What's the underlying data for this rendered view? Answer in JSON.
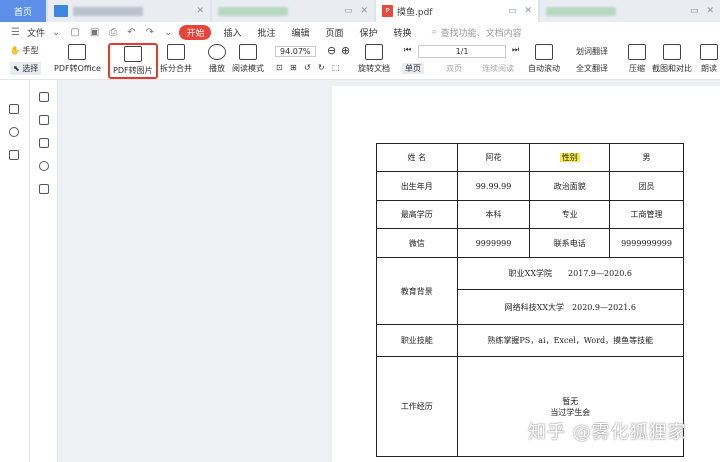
{
  "tabs": {
    "home": "首页",
    "active_file": "摸鱼.pdf"
  },
  "menu": {
    "file": "文件",
    "items": [
      "开始",
      "插入",
      "批注",
      "编辑",
      "页面",
      "保护",
      "转换"
    ],
    "search_placeholder": "查找功能、文档内容"
  },
  "toolbar": {
    "hand": "手型",
    "select": "选择",
    "pdf_to_office": "PDF转Office",
    "pdf_to_image": "PDF转图片",
    "split_merge": "拆分合并",
    "play": "播放",
    "read_mode": "阅读模式",
    "zoom": "94.07%",
    "rotate": "旋转文档",
    "page": "1/1",
    "single": "单页",
    "double": "双页",
    "continuous": "连续阅读",
    "auto_scroll": "自动滚动",
    "translate_word": "划词翻译",
    "translate_full": "全文翻译",
    "compress": "压缩",
    "screenshot": "截图和对比",
    "read_aloud": "朗读"
  },
  "form": {
    "name_label": "姓 名",
    "name": "阿花",
    "gender_label": "性别",
    "gender": "男",
    "birth_label": "出生年月",
    "birth": "99.99.99",
    "politics_label": "政治面貌",
    "politics": "团员",
    "edu_label": "最高学历",
    "edu": "本科",
    "major_label": "专业",
    "major": "工商管理",
    "wechat_label": "微信",
    "wechat": "9999999",
    "phone_label": "联系电话",
    "phone": "9999999999",
    "edu_bg_label": "教育背景",
    "edu_bg_1": "职业XX学院　　2017.9—2020.6",
    "edu_bg_2": "网络科技XX大学　2020.9—2021.6",
    "skill_label": "职业技能",
    "skill": "熟练掌握PS，ai，Excel，Word，摸鱼等技能",
    "work_label": "工作经历",
    "work_1": "暂无",
    "work_2": "当过学生会"
  },
  "watermark": "知乎 @雾化狐狸家"
}
